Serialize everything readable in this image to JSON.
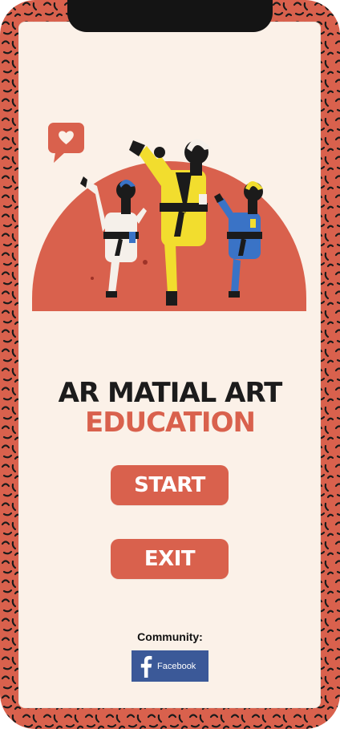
{
  "app": {
    "title_line1": "AR MATIAL ART",
    "title_line2": "EDUCATION"
  },
  "buttons": {
    "start_label": "START",
    "exit_label": "EXIT"
  },
  "community": {
    "label": "Community:",
    "facebook_label": "Facebook",
    "facebook_icon": "facebook-icon"
  },
  "colors": {
    "accent": "#d9614d",
    "background": "#fbf1e8",
    "title_dark": "#1c1c1c",
    "facebook_blue": "#3b5998",
    "karateka_white": "#f5f0ea",
    "karateka_yellow": "#f2dd2e",
    "karateka_blue": "#3a73c6"
  },
  "hero": {
    "illustration": "three-karate-fighters-kicking",
    "badge_icon": "heart-speech-bubble-icon"
  }
}
